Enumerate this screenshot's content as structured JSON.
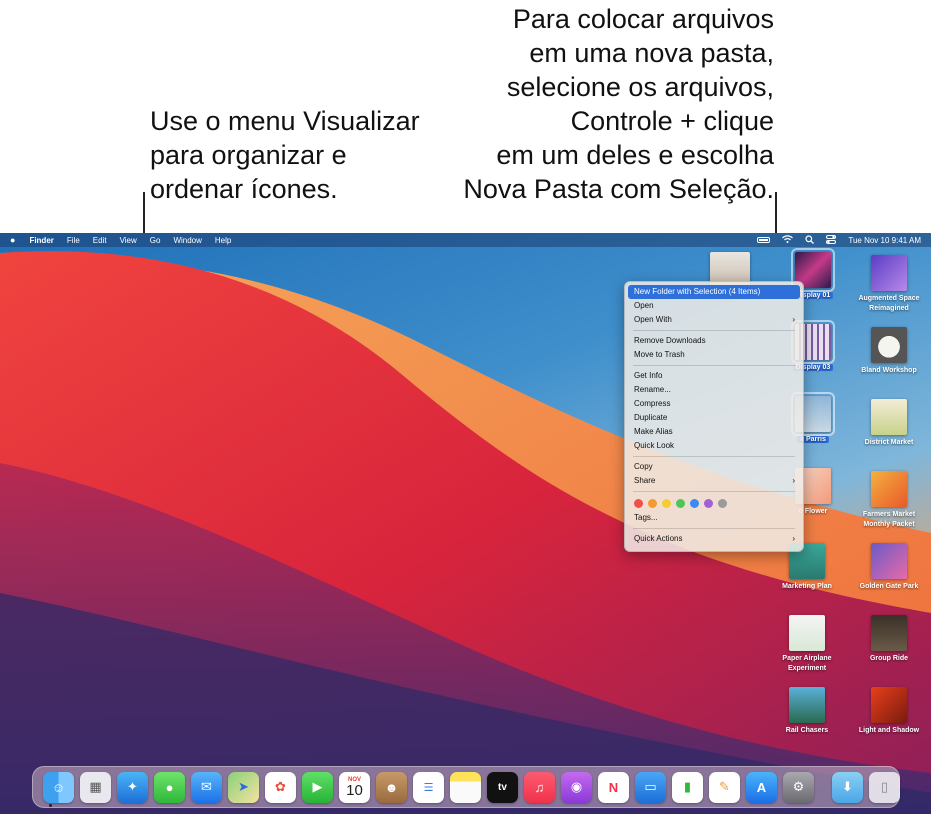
{
  "callouts": {
    "left": "Use o menu Visualizar\npara organizar e\nordenar ícones.",
    "right": "Para colocar arquivos\nem uma nova pasta,\nselecione os arquivos,\nControle + clique\nem um deles e escolha\nNova Pasta com Seleção."
  },
  "menubar": {
    "apple_icon": "apple-logo-icon",
    "items": [
      "Finder",
      "File",
      "Edit",
      "View",
      "Go",
      "Window",
      "Help"
    ],
    "clock": "Tue Nov 10  9:41 AM",
    "status_icons": [
      "battery-icon",
      "wifi-icon",
      "spotlight-search-icon",
      "control-center-icon"
    ]
  },
  "context_menu": {
    "highlighted": "New Folder with Selection (4 Items)",
    "group1": [
      "Open",
      "Open With"
    ],
    "group2": [
      "Remove Downloads",
      "Move to Trash"
    ],
    "group3": [
      "Get Info",
      "Rename...",
      "Compress",
      "Duplicate",
      "Make Alias",
      "Quick Look"
    ],
    "group4": [
      "Copy",
      "Share"
    ],
    "tag_colors": [
      "#f0524a",
      "#f59a2e",
      "#f5cd33",
      "#4fc557",
      "#3a8bf0",
      "#a35fd6",
      "#9a9a9a"
    ],
    "tags_label": "Tags...",
    "quick_actions": "Quick Actions"
  },
  "desktop_icons": {
    "display01": "Display 01",
    "display03": "Display 03",
    "parris": "a Parris",
    "flower": "o Flower",
    "augmented": "Augmented Space Reimagined",
    "bland": "Bland Workshop",
    "district": "District Market",
    "farmers": "Farmers Market Monthly Packet",
    "marketing": "Marketing Plan",
    "golden": "Golden Gate Park",
    "paper": "Paper Airplane Experiment",
    "group": "Group Ride",
    "rail": "Rail Chasers",
    "light": "Light and Shadow"
  },
  "dock": {
    "apps": [
      "finder-icon",
      "launchpad-icon",
      "safari-icon",
      "messages-icon",
      "mail-icon",
      "maps-icon",
      "photos-icon",
      "facetime-icon",
      "calendar-icon",
      "contacts-icon",
      "reminders-icon",
      "notes-icon",
      "apple-tv-icon",
      "music-icon",
      "podcasts-icon",
      "news-icon",
      "keynote-icon",
      "numbers-icon",
      "pages-icon",
      "app-store-icon",
      "system-preferences-icon",
      "downloads-folder-icon",
      "trash-icon"
    ],
    "calendar_month": "NOV",
    "calendar_day": "10",
    "tv_label": "tv"
  }
}
